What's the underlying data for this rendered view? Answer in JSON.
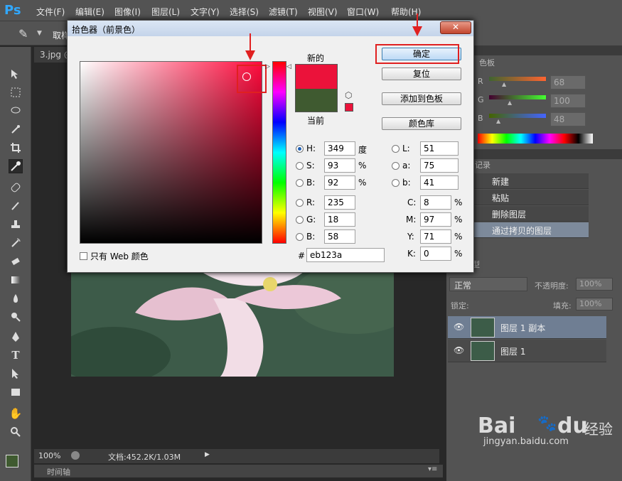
{
  "app": {
    "logo": "Ps"
  },
  "menu": [
    "文件(F)",
    "编辑(E)",
    "图像(I)",
    "图层(L)",
    "文字(Y)",
    "选择(S)",
    "滤镜(T)",
    "视图(V)",
    "窗口(W)",
    "帮助(H)"
  ],
  "window_controls": {
    "minimize": "—",
    "restore": "□",
    "close": "✕"
  },
  "options_bar": {
    "label": "取样"
  },
  "doc_tab": {
    "label": "3.jpg @"
  },
  "status": {
    "zoom": "100%",
    "doc": "文档:452.2K/1.03M"
  },
  "timeline": {
    "label": "时间轴"
  },
  "dialog": {
    "title": "拾色器（前景色）",
    "new_label": "新的",
    "current_label": "当前",
    "new_color": "#eb123a",
    "current_color": "#3f5a30",
    "buttons": {
      "ok": "确定",
      "reset": "复位",
      "add_swatch": "添加到色板",
      "libraries": "颜色库"
    },
    "web_only": "只有 Web 颜色",
    "fields": {
      "H": {
        "label": "H:",
        "value": "349",
        "unit": "度"
      },
      "S": {
        "label": "S:",
        "value": "93",
        "unit": "%"
      },
      "Bv": {
        "label": "B:",
        "value": "92",
        "unit": "%"
      },
      "R": {
        "label": "R:",
        "value": "235"
      },
      "G": {
        "label": "G:",
        "value": "18"
      },
      "B": {
        "label": "B:",
        "value": "58"
      },
      "L": {
        "label": "L:",
        "value": "51"
      },
      "a": {
        "label": "a:",
        "value": "75"
      },
      "b": {
        "label": "b:",
        "value": "41"
      },
      "C": {
        "label": "C:",
        "value": "8",
        "unit": "%"
      },
      "M": {
        "label": "M:",
        "value": "97",
        "unit": "%"
      },
      "Y": {
        "label": "Y:",
        "value": "71",
        "unit": "%"
      },
      "K": {
        "label": "K:",
        "value": "0",
        "unit": "%"
      },
      "hex_label": "#",
      "hex": "eb123a"
    }
  },
  "color_panel": {
    "tab": "色板",
    "R": {
      "label": "R",
      "value": "68"
    },
    "G": {
      "label": "G",
      "value": "100"
    },
    "B": {
      "label": "B",
      "value": "48"
    }
  },
  "history_panel": {
    "tab": "记录",
    "items": [
      "新建",
      "粘贴",
      "删除图层",
      "通过拷贝的图层"
    ]
  },
  "layers_panel": {
    "kind": "型",
    "blend_mode": "正常",
    "opacity_label": "不透明度:",
    "opacity": "100%",
    "lock_label": "锁定:",
    "fill_label": "填充:",
    "fill": "100%",
    "layers": [
      "图层 1 副本",
      "图层 1"
    ]
  },
  "watermark": {
    "brand": "Bai",
    "brand2": "du",
    "cn": "经验",
    "url": "jingyan.baidu.com"
  },
  "colors": {
    "accent_red": "#e02020",
    "ps_blue": "#31a8ff"
  }
}
